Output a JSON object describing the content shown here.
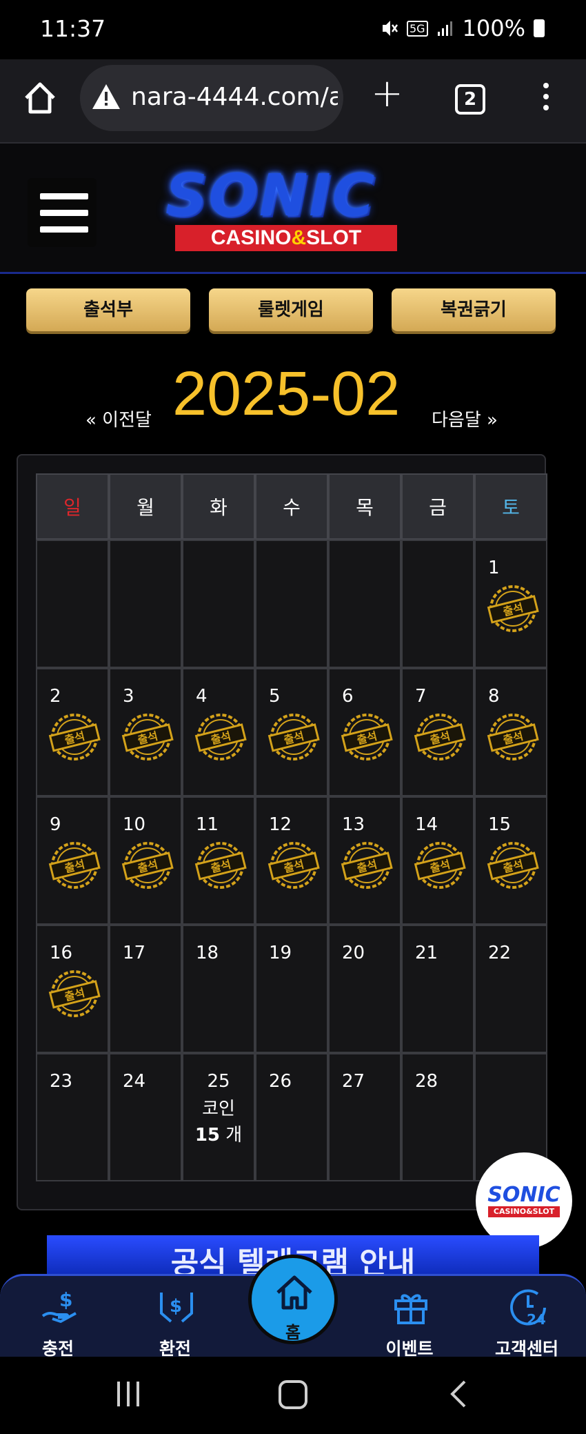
{
  "status_bar": {
    "time": "11:37",
    "battery": "100%",
    "network": "5G"
  },
  "browser": {
    "url": "nara-4444.com/a",
    "tab_count": "2"
  },
  "logo": {
    "brand": "SONIC",
    "subtitle_left": "CASINO",
    "subtitle_amp": "&",
    "subtitle_right": "SLOT"
  },
  "buttons": [
    {
      "label": "출석부"
    },
    {
      "label": "룰렛게임"
    },
    {
      "label": "복권긁기"
    }
  ],
  "calendar": {
    "prev_label": "« 이전달",
    "next_label": "다음달 »",
    "month": "2025-02",
    "weekdays": [
      "일",
      "월",
      "화",
      "수",
      "목",
      "금",
      "토"
    ],
    "weekday_colors": {
      "sunday": "#e0262b",
      "saturday": "#53b6e8",
      "default": "#ffffff"
    },
    "weeks": [
      [
        "",
        "",
        "",
        "",
        "",
        "",
        "1"
      ],
      [
        "2",
        "3",
        "4",
        "5",
        "6",
        "7",
        "8"
      ],
      [
        "9",
        "10",
        "11",
        "12",
        "13",
        "14",
        "15"
      ],
      [
        "16",
        "17",
        "18",
        "19",
        "20",
        "21",
        "22"
      ],
      [
        "23",
        "24",
        "25",
        "26",
        "27",
        "28",
        ""
      ]
    ],
    "attended_days": [
      "1",
      "2",
      "3",
      "4",
      "5",
      "6",
      "7",
      "8",
      "9",
      "10",
      "11",
      "12",
      "13",
      "14",
      "15",
      "16"
    ],
    "stamp_text": "출석",
    "coin_day": "25",
    "coin_label": "코인",
    "coin_count": "15",
    "coin_unit": "개"
  },
  "float_logo": {
    "brand": "SONIC",
    "subtitle": "CASINO&SLOT"
  },
  "banner": {
    "text": "공식 텔레그램 안내"
  },
  "bottom_nav": {
    "items": [
      {
        "label": "충전",
        "icon": "deposit-icon"
      },
      {
        "label": "환전",
        "icon": "withdraw-icon"
      },
      {
        "label": "홈",
        "icon": "home-icon"
      },
      {
        "label": "이벤트",
        "icon": "gift-icon"
      },
      {
        "label": "고객센터",
        "icon": "support-24-icon"
      }
    ]
  },
  "colors": {
    "accent_gold": "#f7c12b",
    "brand_blue": "#1f4fe0",
    "nav_home": "#1b9be8"
  }
}
